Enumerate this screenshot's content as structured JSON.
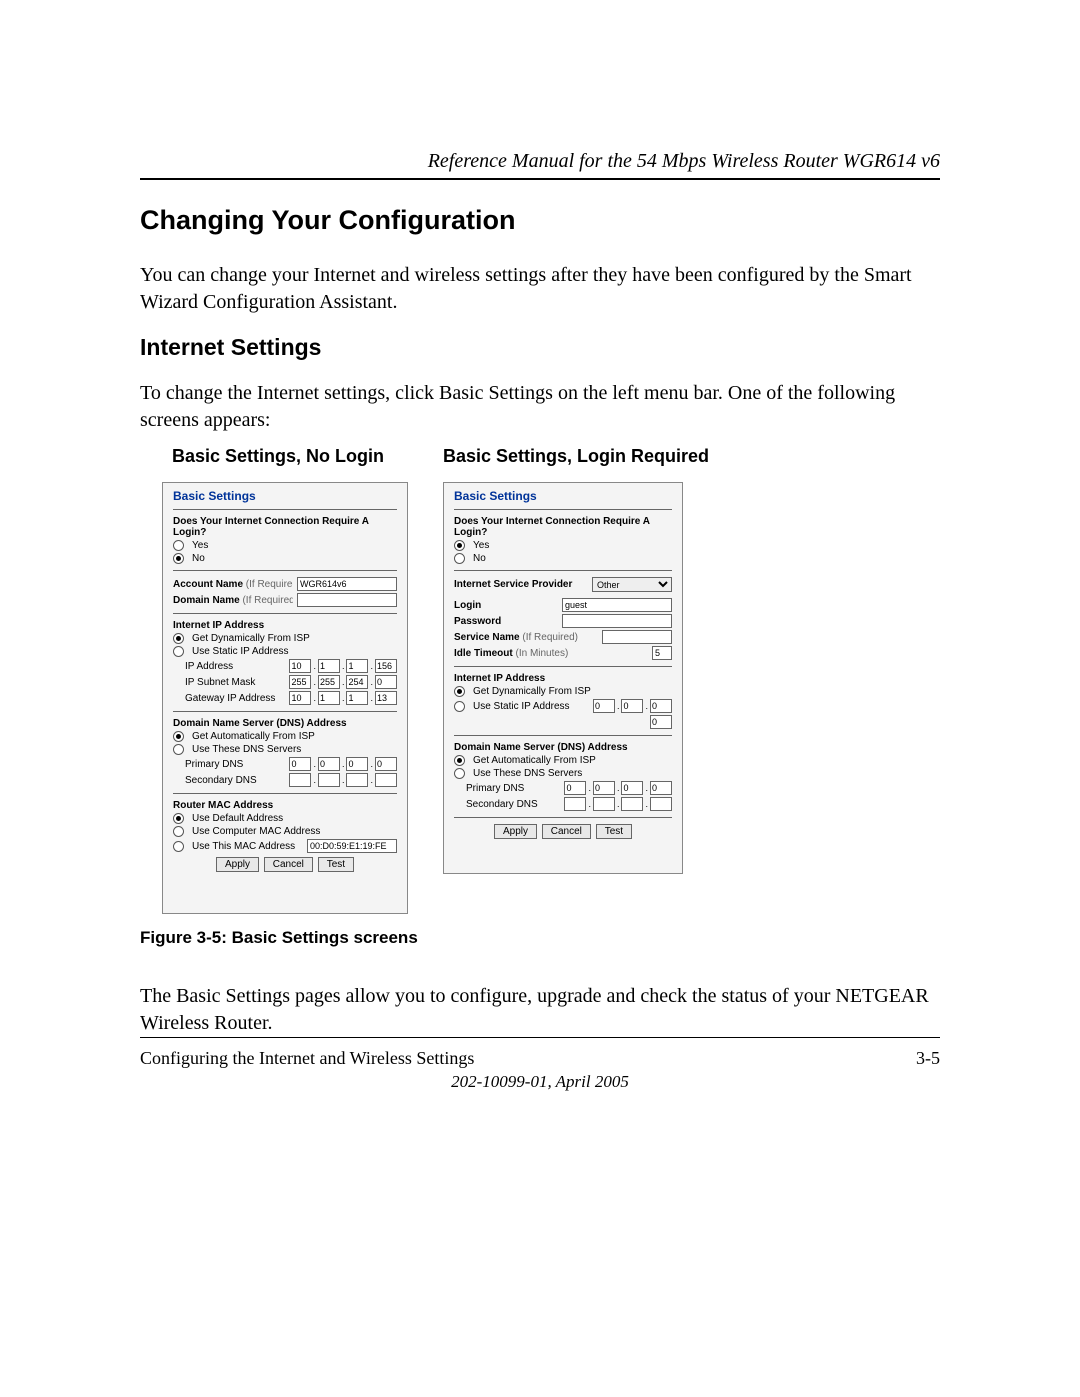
{
  "header": {
    "running_title": "Reference Manual for the 54 Mbps Wireless Router WGR614 v6"
  },
  "section": {
    "heading1": "Changing Your Configuration",
    "para1": "You can change your Internet and wireless settings after they have been configured by the Smart Wizard Configuration Assistant.",
    "heading2": "Internet Settings",
    "para2": "To change the Internet settings, click Basic Settings on the left menu bar. One of the following screens appears:",
    "caption_left": "Basic Settings, No Login",
    "caption_right": "Basic Settings, Login Required",
    "figure_caption": "Figure 3-5:  Basic Settings screens",
    "para3": "The Basic Settings pages allow you to configure, upgrade and check the status of your NETGEAR Wireless Router."
  },
  "footer": {
    "left": "Configuring the Internet and Wireless Settings",
    "right": "3-5",
    "center": "202-10099-01, April 2005"
  },
  "panel_left": {
    "title": "Basic Settings",
    "login_q": "Does Your Internet Connection Require A Login?",
    "yes": "Yes",
    "no": "No",
    "account_name_lbl": "Account Name",
    "if_required": "(If Required)",
    "account_name_val": "WGR614v6",
    "domain_name_lbl": "Domain Name",
    "ip_section": "Internet IP Address",
    "get_dyn": "Get Dynamically From ISP",
    "use_static": "Use Static IP Address",
    "ip_addr_lbl": "IP Address",
    "ip": [
      "10",
      "1",
      "1",
      "156"
    ],
    "subnet_lbl": "IP Subnet Mask",
    "subnet": [
      "255",
      "255",
      "254",
      "0"
    ],
    "gw_lbl": "Gateway IP Address",
    "gw": [
      "10",
      "1",
      "1",
      "13"
    ],
    "dns_section": "Domain Name Server (DNS) Address",
    "dns_auto": "Get Automatically From ISP",
    "dns_use": "Use These DNS Servers",
    "primary_dns_lbl": "Primary DNS",
    "primary_dns": [
      "0",
      "0",
      "0",
      "0"
    ],
    "secondary_dns_lbl": "Secondary DNS",
    "mac_section": "Router MAC Address",
    "mac_default": "Use Default Address",
    "mac_computer": "Use Computer MAC Address",
    "mac_this": "Use This MAC Address",
    "mac_val": "00:D0:59:E1:19:FE",
    "apply": "Apply",
    "cancel": "Cancel",
    "test": "Test"
  },
  "panel_right": {
    "title": "Basic Settings",
    "login_q": "Does Your Internet Connection Require A Login?",
    "yes": "Yes",
    "no": "No",
    "isp_lbl": "Internet Service Provider",
    "isp_val": "Other",
    "login_lbl": "Login",
    "login_val": "guest",
    "password_lbl": "Password",
    "service_lbl": "Service Name",
    "if_required": "(If Required)",
    "idle_lbl": "Idle Timeout",
    "idle_unit": "(In Minutes)",
    "idle_val": "5",
    "ip_section": "Internet IP Address",
    "get_dyn": "Get Dynamically From ISP",
    "use_static": "Use Static IP Address",
    "ip": [
      "0",
      "0",
      "0",
      "0"
    ],
    "dns_section": "Domain Name Server (DNS) Address",
    "dns_auto": "Get Automatically From ISP",
    "dns_use": "Use These DNS Servers",
    "primary_dns_lbl": "Primary DNS",
    "primary_dns": [
      "0",
      "0",
      "0",
      "0"
    ],
    "secondary_dns_lbl": "Secondary DNS",
    "apply": "Apply",
    "cancel": "Cancel",
    "test": "Test"
  }
}
